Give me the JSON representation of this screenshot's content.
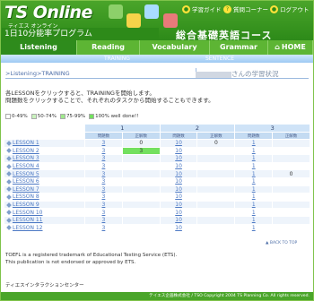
{
  "header": {
    "logo": "TS Online",
    "logo_sub": "ティエス オンライン",
    "subtitle": "1日10分能率プログラム",
    "course": "総合基礎英語コース",
    "links": [
      {
        "label": "学習ガイド",
        "icon": "book-icon"
      },
      {
        "label": "質問コーナー",
        "icon": "question-icon"
      },
      {
        "label": "ログアウト",
        "icon": "logout-icon"
      }
    ]
  },
  "tabs": [
    {
      "label": "Listening",
      "active": true
    },
    {
      "label": "Reading"
    },
    {
      "label": "Vocabulary"
    },
    {
      "label": "Grammar"
    }
  ],
  "home_label": "HOME",
  "subnav": {
    "left": "TRAINING",
    "right": "SENTENCE"
  },
  "breadcrumb": {
    "root": ">Listening",
    "current": ">TRAINING"
  },
  "user": {
    "suffix": "さんの学習状況"
  },
  "intro": [
    "各LESSONをクリックすると、TRAININGを開始します。",
    "問題数をクリックすることで、それぞれのタスクから開始することもできます。"
  ],
  "legend": [
    {
      "label": "0-49%",
      "color": "#ffffff"
    },
    {
      "label": "50-74%",
      "color": "#c9f2bd"
    },
    {
      "label": "75-99%",
      "color": "#9fe98c"
    },
    {
      "label": "100% well done!!",
      "color": "#73e05f"
    }
  ],
  "table": {
    "groups": [
      "1",
      "2",
      "3"
    ],
    "subheaders": [
      "問題数",
      "正解数"
    ],
    "rows": [
      {
        "label": "LESSON 1",
        "c": [
          "3",
          "0",
          "10",
          "0",
          "1",
          ""
        ]
      },
      {
        "label": "LESSON 2",
        "c": [
          "3",
          "3",
          "10",
          "",
          "1",
          ""
        ],
        "green": [
          1
        ]
      },
      {
        "label": "LESSON 3",
        "c": [
          "3",
          "",
          "10",
          "",
          "1",
          ""
        ]
      },
      {
        "label": "LESSON 4",
        "c": [
          "3",
          "",
          "10",
          "",
          "1",
          ""
        ]
      },
      {
        "label": "LESSON 5",
        "c": [
          "3",
          "",
          "10",
          "",
          "1",
          "0"
        ]
      },
      {
        "label": "LESSON 6",
        "c": [
          "3",
          "",
          "10",
          "",
          "1",
          ""
        ]
      },
      {
        "label": "LESSON 7",
        "c": [
          "3",
          "",
          "10",
          "",
          "1",
          ""
        ]
      },
      {
        "label": "LESSON 8",
        "c": [
          "3",
          "",
          "10",
          "",
          "1",
          ""
        ]
      },
      {
        "label": "LESSON 9",
        "c": [
          "3",
          "",
          "10",
          "",
          "1",
          ""
        ]
      },
      {
        "label": "LESSON 10",
        "c": [
          "3",
          "",
          "10",
          "",
          "1",
          ""
        ]
      },
      {
        "label": "LESSON 11",
        "c": [
          "3",
          "",
          "10",
          "",
          "1",
          ""
        ]
      },
      {
        "label": "LESSON 12",
        "c": [
          "3",
          "",
          "10",
          "",
          "1",
          ""
        ]
      }
    ]
  },
  "back_to_top": "▲ BACK TO TOP",
  "notes": [
    "TOEFL is a registered trademark of Educational Testing Service (ETS).",
    "This publication is not endorsed or approved by ETS."
  ],
  "company": "ティエスインタラクションセンター",
  "footer": "テイエス企画株式会社 / TSO Copyright 2004 TS Planning Co. All rights reserved."
}
